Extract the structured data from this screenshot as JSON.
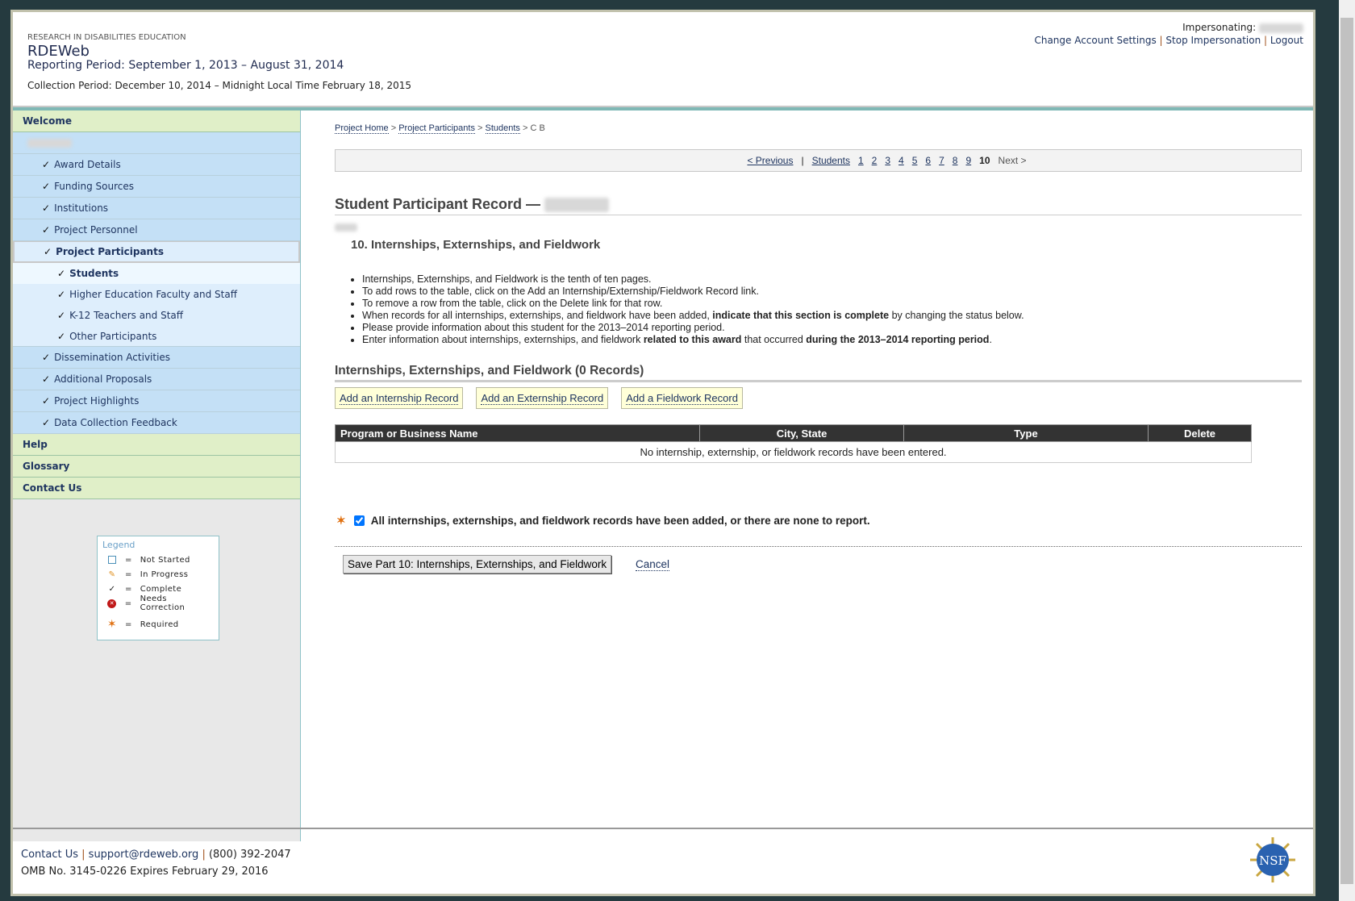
{
  "header": {
    "org": "RESEARCH IN DISABILITIES EDUCATION",
    "app": "RDEWeb",
    "reporting_period": "Reporting Period: September 1, 2013 – August 31, 2014",
    "collection_period": "Collection Period: December 10, 2014 – Midnight Local Time February 18, 2015",
    "impersonating_label": "Impersonating:",
    "links": [
      "Change Account Settings",
      "Stop Impersonation",
      "Logout"
    ]
  },
  "sidebar": {
    "welcome": "Welcome",
    "items": [
      "Award Details",
      "Funding Sources",
      "Institutions",
      "Project Personnel",
      "Project Participants"
    ],
    "sub_items": [
      "Students",
      "Higher Education Faculty and Staff",
      "K-12 Teachers and Staff",
      "Other Participants"
    ],
    "items2": [
      "Dissemination Activities",
      "Additional Proposals",
      "Project Highlights",
      "Data Collection Feedback"
    ],
    "bottom": [
      "Help",
      "Glossary",
      "Contact Us"
    ],
    "check": "✓"
  },
  "legend": {
    "title": "Legend",
    "eq": "=",
    "rows": [
      {
        "icon": "not-started-icon",
        "label": "Not Started"
      },
      {
        "icon": "pencil-icon",
        "label": "In Progress"
      },
      {
        "icon": "check-icon",
        "label": "Complete"
      },
      {
        "icon": "error-icon",
        "label": "Needs Correction"
      },
      {
        "icon": "required-star-icon",
        "label": "Required"
      }
    ]
  },
  "breadcrumb": [
    "Project Home",
    "Project Participants",
    "Students",
    "C B"
  ],
  "pager": {
    "previous": "< Previous",
    "students": "Students",
    "pages": [
      "1",
      "2",
      "3",
      "4",
      "5",
      "6",
      "7",
      "8",
      "9"
    ],
    "current": "10",
    "next": "Next >"
  },
  "main": {
    "title": "Student Participant Record —",
    "section": "10. Internships, Externships, and Fieldwork",
    "bullets": [
      [
        "Internships, Externships, and Fieldwork is the tenth of ten pages.",
        "",
        ""
      ],
      [
        "To add rows to the table, click on the Add an Internship/Externship/Fieldwork Record link.",
        "",
        ""
      ],
      [
        "To remove a row from the table, click on the Delete link for that row.",
        "",
        ""
      ],
      [
        "When records for all internships, externships, and fieldwork have been added, ",
        "indicate that this section is complete",
        " by changing the status below."
      ],
      [
        "Please provide information about this student for the 2013–2014 reporting period.",
        "",
        ""
      ],
      [
        "Enter information about internships, externships, and fieldwork ",
        "related to this award",
        " that occurred "
      ]
    ],
    "bullet6_bold2": "during the 2013–2014 reporting period",
    "bullet6_end": ".",
    "records_heading": "Internships, Externships, and Fieldwork (0 Records)",
    "buttons": [
      "Add an Internship Record",
      "Add an Externship Record",
      "Add a Fieldwork Record"
    ],
    "table": {
      "columns": [
        "Program or Business Name",
        "City, State",
        "Type",
        "Delete"
      ],
      "empty": "No internship, externship, or fieldwork records have been entered."
    },
    "complete_label": "All internships, externships, and fieldwork records have been added, or there are none to report.",
    "complete_checked": true,
    "save": "Save Part 10: Internships, Externships, and Fieldwork",
    "cancel": "Cancel"
  },
  "footer": {
    "contact": "Contact Us",
    "email": "support@rdeweb.org",
    "phone": "(800) 392-2047",
    "omb": "OMB No. 3145-0226 Expires February 29, 2016",
    "logo": "NSF"
  }
}
